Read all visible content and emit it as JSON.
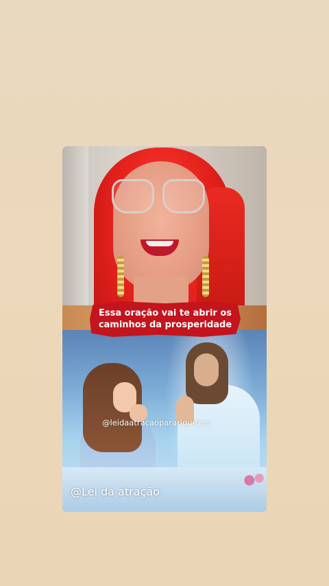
{
  "video": {
    "caption_line1": "Essa oração vai te abrir os",
    "caption_line2": "caminhos da prosperidade",
    "watermark_handle": "@leidaatracaopararíquezas",
    "watermark_channel": "@Lei da atração"
  },
  "colors": {
    "caption_background": "#c4141d",
    "page_background": "#ecd8ba"
  }
}
